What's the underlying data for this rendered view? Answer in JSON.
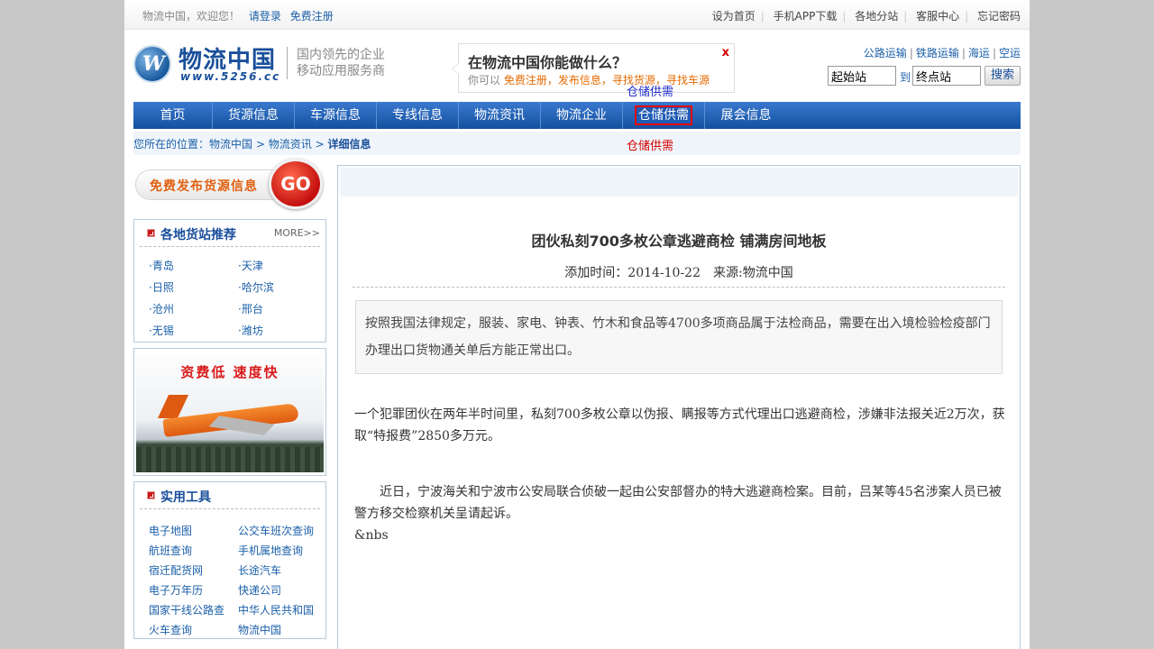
{
  "topbar": {
    "welcome": "物流中国，欢迎您！",
    "login": "请登录",
    "register": "免费注册",
    "links": [
      "设为首页",
      "手机APP下载",
      "各地分站",
      "客服中心",
      "忘记密码"
    ]
  },
  "header": {
    "logo_cn": "物流中国",
    "logo_url": "www.5256.cc",
    "slogan_line1": "国内领先的企业",
    "slogan_line2": "移动应用服务商",
    "promo_title": "在物流中国你能做什么？",
    "promo_close": "x",
    "promo_prefix": "你可以",
    "promo_items": [
      "免费注册",
      "发布信息",
      "寻找货源",
      "寻找车源"
    ],
    "transport": [
      "公路运输",
      "铁路运输",
      "海运",
      "空运"
    ],
    "search_from": "起始站",
    "search_mid": "到",
    "search_to": "终点站",
    "search_button": "搜索"
  },
  "nav": {
    "items": [
      "首页",
      "货源信息",
      "车源信息",
      "专线信息",
      "物流资讯",
      "物流企业",
      "仓储供需",
      "展会信息"
    ]
  },
  "tooltip": "仓储供需",
  "breadcrumb": {
    "prefix": "您所在的位置：",
    "home": "物流中国",
    "sep": ">",
    "section": "物流资讯",
    "current": "详细信息"
  },
  "left": {
    "go_banner_text": "免费发布货源信息",
    "go_label": "GO",
    "stations_title": "各地货站推荐",
    "stations_more": "MORE>>",
    "stations": [
      "·青岛",
      "·天津",
      "·日照",
      "·哈尔滨",
      "·沧州",
      "·邢台",
      "·无锡",
      "·潍坊"
    ],
    "ad_caption": "资费低  速度快",
    "tools_title": "实用工具",
    "tools": [
      "电子地图",
      "公交车班次查询",
      "航班查询",
      "手机属地查询",
      "宿迁配货网",
      "长途汽车",
      "电子万年历",
      "快递公司",
      "国家干线公路查",
      "中华人民共和国",
      "火车查询",
      "物流中国"
    ]
  },
  "article": {
    "title": "团伙私刻700多枚公章逃避商检 铺满房间地板",
    "meta": "添加时间：2014-10-22　来源:物流中国",
    "summary": "按照我国法律规定，服装、家电、钟表、竹木和食品等4700多项商品属于法检商品，需要在出入境检验检疫部门办理出口货物通关单后方能正常出口。",
    "p1": " 一个犯罪团伙在两年半时间里，私刻700多枚公章以伪报、瞒报等方式代理出口逃避商检，涉嫌非法报关近2万次，获取“特报费”2850多万元。",
    "p2": "　　近日，宁波海关和宁波市公安局联合侦破一起由公安部督办的特大逃避商检案。目前，吕某等45名涉案人员已被警方移交检察机关呈请起诉。",
    "p3": "&nbs"
  },
  "colors": {
    "nav_top": "#3a79cf",
    "nav_bottom": "#13509f",
    "link": "#1a5fa8",
    "accent_orange": "#e66a00",
    "highlight_red": "#d40000"
  }
}
